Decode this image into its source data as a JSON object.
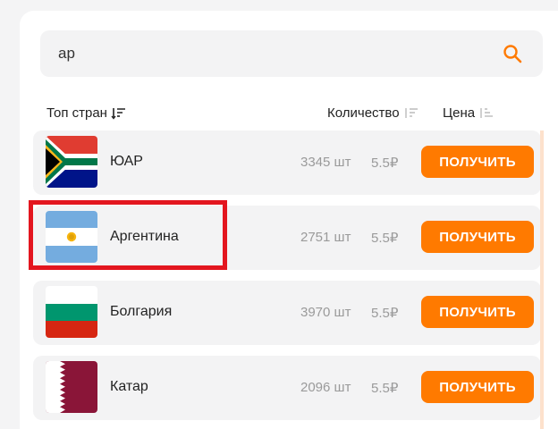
{
  "search": {
    "value": "ар",
    "placeholder": ""
  },
  "table_header": {
    "top_label": "Топ стран",
    "quantity_label": "Количество",
    "price_label": "Цена"
  },
  "rows": [
    {
      "country": "ЮАР",
      "count": "3345 шт",
      "price": "5.5₽",
      "button": "ПОЛУЧИТЬ",
      "flag": "south-africa"
    },
    {
      "country": "Аргентина",
      "count": "2751 шт",
      "price": "5.5₽",
      "button": "ПОЛУЧИТЬ",
      "flag": "argentina"
    },
    {
      "country": "Болгария",
      "count": "3970 шт",
      "price": "5.5₽",
      "button": "ПОЛУЧИТЬ",
      "flag": "bulgaria"
    },
    {
      "country": "Катар",
      "count": "2096 шт",
      "price": "5.5₽",
      "button": "ПОЛУЧИТЬ",
      "flag": "qatar"
    }
  ],
  "colors": {
    "accent": "#ff7a00",
    "highlight": "#e3161f",
    "row_bg": "#f3f3f4"
  }
}
